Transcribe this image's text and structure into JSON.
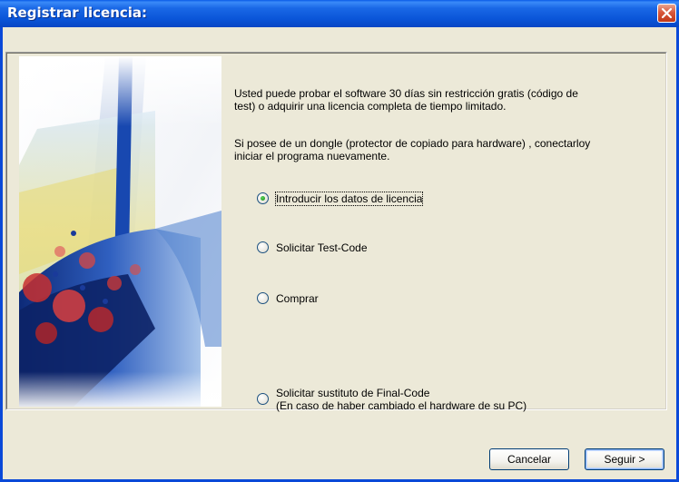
{
  "window": {
    "title": "Registrar licencia:"
  },
  "icons": {
    "close": "close-icon",
    "radio_selected": "radio-selected-icon"
  },
  "colors": {
    "titlebar": "#0a55d8",
    "close_button": "#d8583c",
    "dialog_background": "#ece9d8"
  },
  "content": {
    "intro_text": "Usted puede probar  el software 30 días sin restricción gratis (código de test) o adquirir una licencia completa de tiempo limitado.",
    "intro_line1": "Usted puede probar  el software 30 días sin restricción gratis (código de",
    "intro_line2": "test) o adquirir una licencia completa de tiempo limitado.",
    "dongle_line1": "Si posee de un dongle (protector de copiado para hardware) , conectarloy",
    "dongle_line2": "iniciar el programa nuevamente."
  },
  "options": [
    {
      "label": "Introducir los datos de licencia",
      "selected": true
    },
    {
      "label": "Solicitar Test-Code",
      "selected": false
    },
    {
      "label": "Comprar",
      "selected": false
    },
    {
      "label_line1": "Solicitar sustituto de  Final-Code",
      "label_line2": "(En caso de haber cambiado el hardware de su PC)",
      "selected": false
    }
  ],
  "buttons": {
    "cancel": "Cancelar",
    "next": "Seguir >"
  }
}
